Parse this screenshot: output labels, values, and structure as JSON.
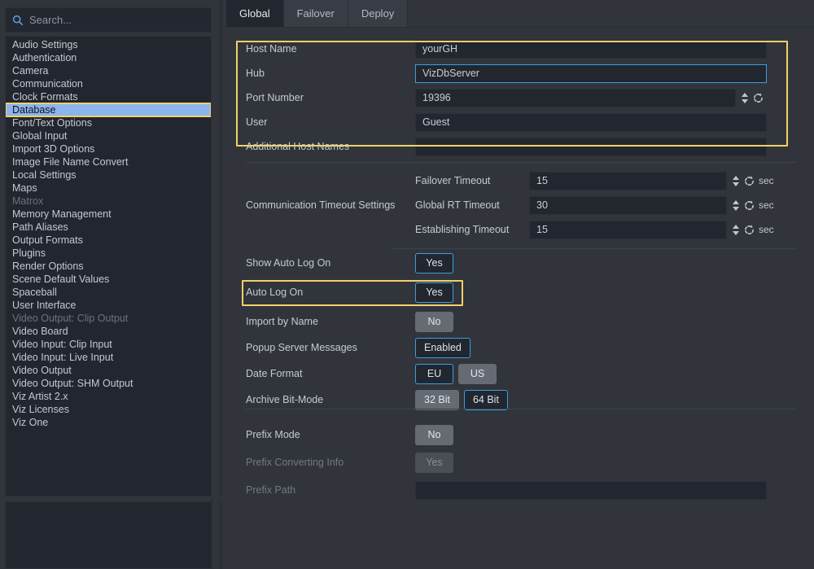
{
  "search": {
    "placeholder": "Search...",
    "icon": "search-icon"
  },
  "sidebar": {
    "items": [
      {
        "label": "Audio Settings",
        "state": "normal"
      },
      {
        "label": "Authentication",
        "state": "normal"
      },
      {
        "label": "Camera",
        "state": "normal"
      },
      {
        "label": "Communication",
        "state": "normal"
      },
      {
        "label": "Clock Formats",
        "state": "normal"
      },
      {
        "label": "Database",
        "state": "selected"
      },
      {
        "label": "Font/Text Options",
        "state": "normal"
      },
      {
        "label": "Global Input",
        "state": "normal"
      },
      {
        "label": "Import 3D Options",
        "state": "normal"
      },
      {
        "label": "Image File Name Convert",
        "state": "normal"
      },
      {
        "label": "Local Settings",
        "state": "normal"
      },
      {
        "label": "Maps",
        "state": "normal"
      },
      {
        "label": "Matrox",
        "state": "disabled"
      },
      {
        "label": "Memory Management",
        "state": "normal"
      },
      {
        "label": "Path Aliases",
        "state": "normal"
      },
      {
        "label": "Output Formats",
        "state": "normal"
      },
      {
        "label": "Plugins",
        "state": "normal"
      },
      {
        "label": "Render Options",
        "state": "normal"
      },
      {
        "label": "Scene Default Values",
        "state": "normal"
      },
      {
        "label": "Spaceball",
        "state": "normal"
      },
      {
        "label": "User Interface",
        "state": "normal"
      },
      {
        "label": "Video Output: Clip Output",
        "state": "disabled"
      },
      {
        "label": "Video Board",
        "state": "normal"
      },
      {
        "label": "Video Input: Clip Input",
        "state": "normal"
      },
      {
        "label": "Video Input: Live Input",
        "state": "normal"
      },
      {
        "label": "Video Output",
        "state": "normal"
      },
      {
        "label": "Video Output: SHM Output",
        "state": "normal"
      },
      {
        "label": "Viz Artist 2.x",
        "state": "normal"
      },
      {
        "label": "Viz Licenses",
        "state": "normal"
      },
      {
        "label": "Viz One",
        "state": "normal"
      }
    ]
  },
  "tabs": [
    {
      "label": "Global",
      "active": true
    },
    {
      "label": "Failover",
      "active": false
    },
    {
      "label": "Deploy",
      "active": false
    }
  ],
  "form": {
    "host_name": {
      "label": "Host Name",
      "value": "yourGH"
    },
    "hub": {
      "label": "Hub",
      "value": "VizDbServer"
    },
    "port": {
      "label": "Port Number",
      "value": "19396"
    },
    "user": {
      "label": "User",
      "value": "Guest"
    },
    "additional": {
      "label": "Additional Host Names",
      "value": ""
    },
    "timeouts": {
      "label": "Communication Timeout Settings",
      "unit": "sec",
      "rows": [
        {
          "name": "Failover Timeout",
          "value": "15"
        },
        {
          "name": "Global RT Timeout",
          "value": "30"
        },
        {
          "name": "Establishing Timeout",
          "value": "15"
        }
      ]
    },
    "show_auto_log_on": {
      "label": "Show Auto Log On",
      "value": "Yes",
      "state": "on"
    },
    "auto_log_on": {
      "label": "Auto Log On",
      "value": "Yes",
      "state": "on"
    },
    "import_by_name": {
      "label": "Import by Name",
      "value": "No",
      "state": "off"
    },
    "popup_server": {
      "label": "Popup Server Messages",
      "value": "Enabled",
      "state": "on"
    },
    "date_format": {
      "label": "Date Format",
      "options": [
        {
          "label": "EU",
          "state": "on"
        },
        {
          "label": "US",
          "state": "off"
        }
      ]
    },
    "archive_bit_mode": {
      "label": "Archive Bit-Mode",
      "options": [
        {
          "label": "32 Bit",
          "state": "off"
        },
        {
          "label": "64 Bit",
          "state": "on"
        }
      ]
    },
    "prefix_mode": {
      "label": "Prefix Mode",
      "value": "No",
      "state": "off"
    },
    "prefix_converting": {
      "label": "Prefix Converting Info",
      "value": "Yes",
      "state": "disabled"
    },
    "prefix_path": {
      "label": "Prefix Path",
      "value": ""
    }
  },
  "colors": {
    "highlight": "#f2d06b",
    "accent": "#3b9ee0",
    "selection": "#8cb4ee",
    "panel_bg": "#31353b",
    "field_bg": "#22262e"
  }
}
